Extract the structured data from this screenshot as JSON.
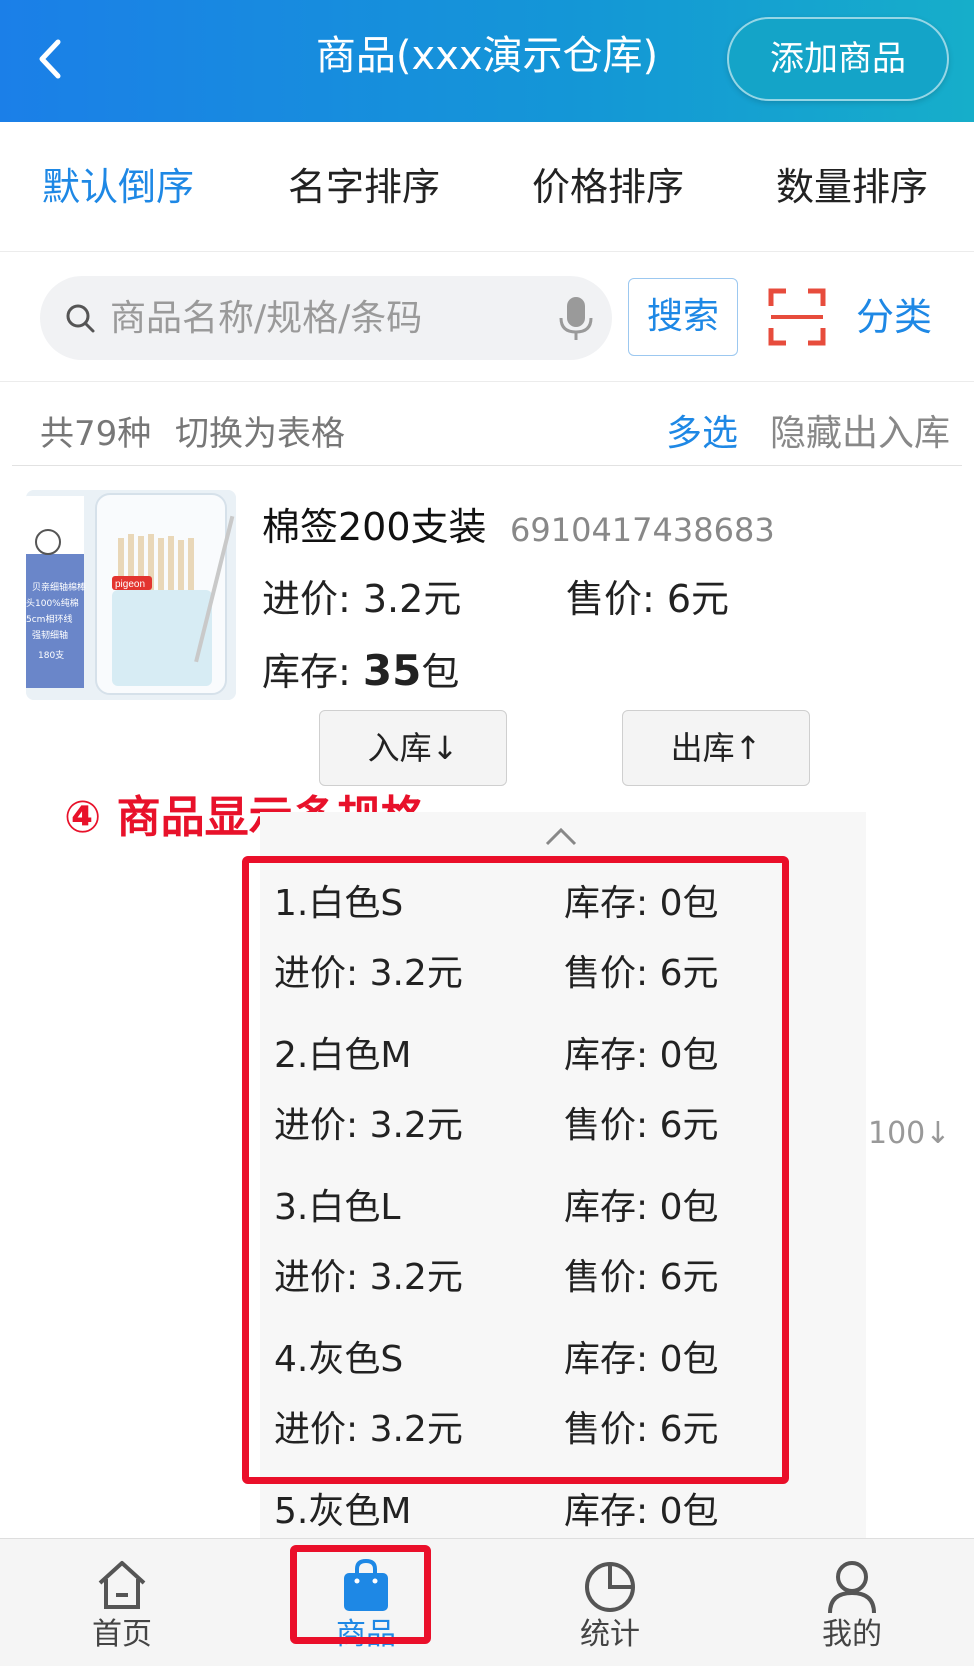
{
  "header": {
    "back_icon": "chevron-left-icon",
    "title": "商品(xxx演示仓库)",
    "add_button": "添加商品"
  },
  "sort_tabs": [
    {
      "label": "默认倒序",
      "active": true
    },
    {
      "label": "名字排序",
      "active": false
    },
    {
      "label": "价格排序",
      "active": false
    },
    {
      "label": "数量排序",
      "active": false
    }
  ],
  "search": {
    "placeholder": "商品名称/规格/条码",
    "value": "",
    "search_button": "搜索",
    "scan_icon": "scan-icon",
    "category_button": "分类"
  },
  "summary": {
    "count": "共79种",
    "switch_view": "切换为表格",
    "multi_select": "多选",
    "hide_io": "隐藏出入库"
  },
  "product": {
    "name": "棉签200支装",
    "barcode": "6910417438683",
    "purchase_price": "进价: 3.2元",
    "sale_price": "售价: 6元",
    "stock_label": "库存: ",
    "stock_value": "35",
    "stock_unit": "包",
    "in_button": "入库↓",
    "out_button": "出库↑",
    "thumb_text": [
      "pigeon",
      "贝亲细轴棉棒",
      "头100%纯棉",
      "5cm相环线",
      "强韧细轴",
      "180支"
    ]
  },
  "annotation": "④ 商品显示多规格",
  "specs": [
    {
      "name": "1.白色S",
      "stock": "库存: 0包",
      "purchase": "进价: 3.2元",
      "sale": "售价: 6元"
    },
    {
      "name": "2.白色M",
      "stock": "库存: 0包",
      "purchase": "进价: 3.2元",
      "sale": "售价: 6元"
    },
    {
      "name": "3.白色L",
      "stock": "库存: 0包",
      "purchase": "进价: 3.2元",
      "sale": "售价: 6元"
    },
    {
      "name": "4.灰色S",
      "stock": "库存: 0包",
      "purchase": "进价: 3.2元",
      "sale": "售价: 6元"
    },
    {
      "name": "5.灰色M",
      "stock": "库存: 0包"
    }
  ],
  "side_value": "100↓",
  "bottom_nav": [
    {
      "label": "首页",
      "icon": "home-icon",
      "active": false
    },
    {
      "label": "商品",
      "icon": "shopping-bag-icon",
      "active": true
    },
    {
      "label": "统计",
      "icon": "pie-chart-icon",
      "active": false
    },
    {
      "label": "我的",
      "icon": "user-icon",
      "active": false
    }
  ],
  "colors": {
    "accent": "#1e88e5",
    "header_start": "#1b7fe8",
    "header_end": "#16aeca",
    "annotation_red": "#ea0f2a"
  }
}
